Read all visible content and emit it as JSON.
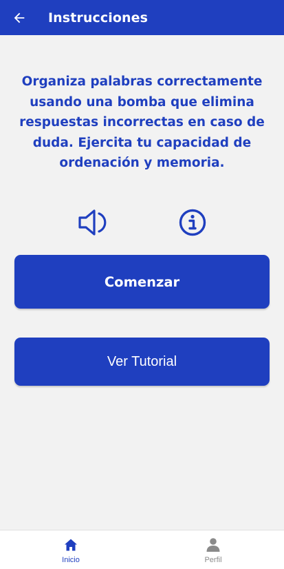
{
  "colors": {
    "primary": "#1f3fbf",
    "background": "#f2f2f2",
    "inactive": "#8a8a8a"
  },
  "appbar": {
    "title": "Instrucciones",
    "back_icon": "arrow-left-icon"
  },
  "description": "Organiza palabras correctamente usando una bomba que elimina respuestas incorrectas en caso de duda. Ejercita tu capacidad de ordenación y memoria.",
  "icons": {
    "sound": "speaker-icon",
    "info": "info-icon"
  },
  "buttons": {
    "start": "Comenzar",
    "tutorial": "Ver Tutorial"
  },
  "bottom_nav": [
    {
      "label": "Inicio",
      "icon": "home-icon",
      "active": true
    },
    {
      "label": "Perfil",
      "icon": "person-icon",
      "active": false
    }
  ]
}
